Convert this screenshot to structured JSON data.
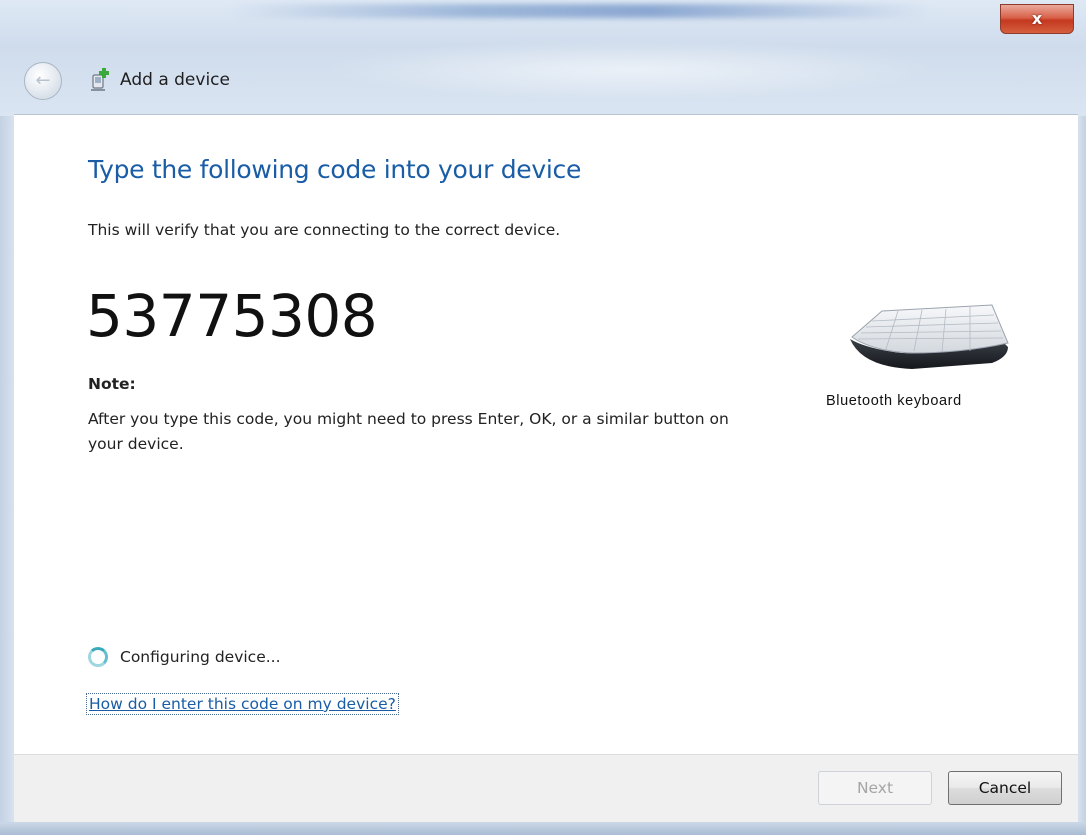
{
  "window": {
    "title": "Add a device",
    "close_glyph": "x",
    "back_glyph": "←",
    "title_icon": "add-device-icon"
  },
  "main": {
    "instruction": "Type the following code into your device",
    "subtitle": "This will verify that you are connecting to the correct device.",
    "pairing_code": "53775308",
    "note_heading": "Note:",
    "note_body": "After you type this code, you might need to press Enter, OK, or a similar button on your device."
  },
  "device": {
    "image": "keyboard-icon",
    "label": "Bluetooth keyboard"
  },
  "status": {
    "icon": "spinner-icon",
    "text": "Configuring device..."
  },
  "help": {
    "link_text": "How do I enter this code on my device?"
  },
  "footer": {
    "next_label": "Next",
    "next_enabled": false,
    "cancel_label": "Cancel"
  },
  "colors": {
    "accent_blue": "#1a5da6",
    "close_red": "#c4381f",
    "frame_blue": "#cfdcec"
  }
}
